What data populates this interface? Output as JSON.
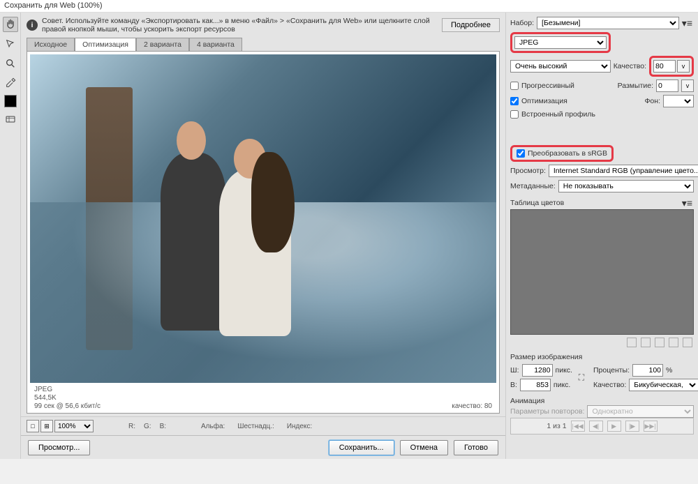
{
  "window": {
    "title": "Сохранить для Web (100%)"
  },
  "tip": {
    "text": "Совет. Используйте команду «Экспортировать как...» в меню «Файл» > «Сохранить для Web» или щелкните слой правой кнопкой мыши, чтобы ускорить экспорт ресурсов",
    "more": "Подробнее"
  },
  "tabs": {
    "source": "Исходное",
    "optimized": "Оптимизация",
    "two_up": "2 варианта",
    "four_up": "4 варианта"
  },
  "preview": {
    "format": "JPEG",
    "size": "544,5K",
    "time": "99 сек @ 56,6 кбит/с",
    "quality_label": "качество: 80"
  },
  "bottom": {
    "zoom": "100%",
    "r": "R:",
    "g": "G:",
    "b": "B:",
    "alpha": "Альфа:",
    "hex": "Шестнадц.:",
    "index": "Индекс:"
  },
  "settings": {
    "preset_label": "Набор:",
    "preset_value": "[Безымени]",
    "format": "JPEG",
    "quality_preset": "Очень высокий",
    "quality_label": "Качество:",
    "quality_value": "80",
    "progressive": "Прогрессивный",
    "blur_label": "Размытие:",
    "blur_value": "0",
    "optimized": "Оптимизация",
    "matte_label": "Фон:",
    "embed_profile": "Встроенный профиль",
    "convert_srgb": "Преобразовать в sRGB",
    "preview_label": "Просмотр:",
    "preview_value": "Internet Standard RGB (управление цвето...",
    "metadata_label": "Метаданные:",
    "metadata_value": "Не показывать",
    "color_table": "Таблица цветов",
    "image_size": "Размер изображения",
    "w_label": "Ш:",
    "w_value": "1280",
    "h_label": "В:",
    "h_value": "853",
    "px": "пикс.",
    "percent_label": "Проценты:",
    "percent_value": "100",
    "percent_suffix": "%",
    "quality2_label": "Качество:",
    "quality2_value": "Бикубическая, че...",
    "animation": "Анимация",
    "loop_label": "Параметры повторов:",
    "loop_value": "Однократно",
    "page": "1 из 1"
  },
  "footer": {
    "preview": "Просмотр...",
    "save": "Сохранить...",
    "cancel": "Отмена",
    "done": "Готово"
  }
}
